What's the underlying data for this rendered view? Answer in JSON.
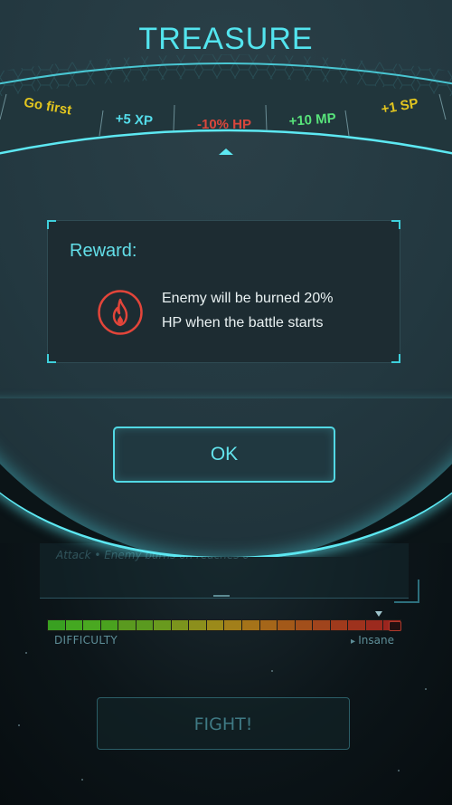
{
  "dialog": {
    "title": "TREASURE",
    "options": [
      {
        "label": "Go first",
        "color": "#e2c51f"
      },
      {
        "label": "+5 XP",
        "color": "#54dcea"
      },
      {
        "label": "-10% HP",
        "color": "#d9473c"
      },
      {
        "label": "+10 MP",
        "color": "#57e27a"
      },
      {
        "label": "+1 SP",
        "color": "#e2c51f"
      }
    ],
    "selected_index": 2,
    "reward_title": "Reward:",
    "reward_line1": "Enemy will be burned 20%",
    "reward_line2": "HP when the battle starts",
    "reward_icon": "fire-icon",
    "ok_label": "OK"
  },
  "background": {
    "panel_text": "Attack • Enemy burns on reaches 0",
    "difficulty_label": "DIFFICULTY",
    "difficulty_level": "Insane",
    "fight_label": "FIGHT!"
  },
  "colors": {
    "accent": "#53e4ee",
    "danger": "#e2453a"
  }
}
